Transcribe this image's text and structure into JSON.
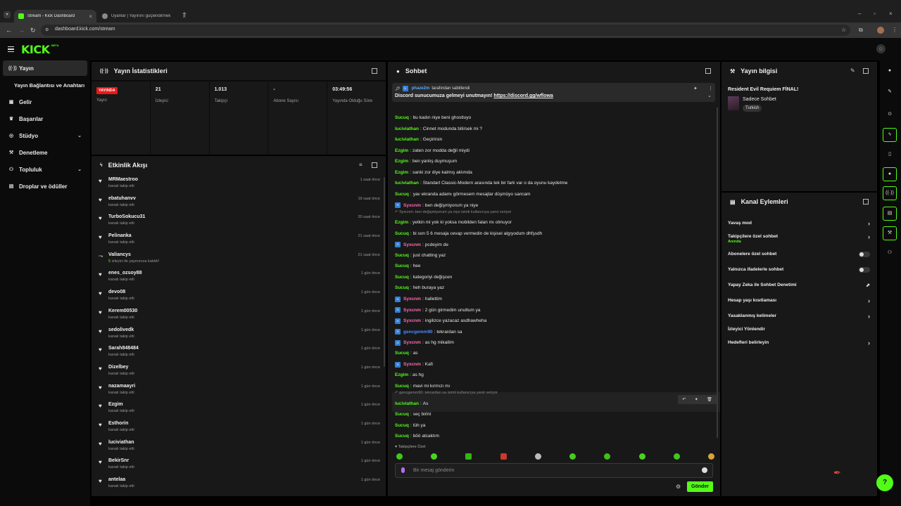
{
  "browser": {
    "tabs": [
      {
        "title": "Stream - Kick Dashboard"
      },
      {
        "title": "Uyanlar | Yayınını güçlendirmek"
      }
    ],
    "url": "dashboard.kick.com/stream"
  },
  "header": {
    "logo": "KICK",
    "logo_badge": "BETA"
  },
  "sidebar": {
    "items": [
      {
        "label": "Yayın",
        "icon": "broadcast-icon"
      },
      {
        "label": "Yayın Bağlantısı ve Anahtarı",
        "icon": ""
      },
      {
        "label": "Gelir",
        "icon": "wallet-icon"
      },
      {
        "label": "Başarılar",
        "icon": "trophy-icon"
      },
      {
        "label": "Stüdyo",
        "icon": "studio-icon"
      },
      {
        "label": "Denetleme",
        "icon": "wrench-icon"
      },
      {
        "label": "Topluluk",
        "icon": "community-icon"
      },
      {
        "label": "Droplar ve ödüller",
        "icon": "gift-icon"
      }
    ]
  },
  "stats": {
    "title": "Yayın İstatistikleri",
    "live_badge": "YAYINDA",
    "cells": [
      {
        "value": "",
        "label": "Yayın"
      },
      {
        "value": "21",
        "label": "İzleyici"
      },
      {
        "value": "1.013",
        "label": "Takipçi"
      },
      {
        "value": "-",
        "label": "Abone Sayısı"
      },
      {
        "value": "03:49:56",
        "label": "Yayında Olduğu Süre"
      }
    ]
  },
  "activity": {
    "title": "Etkinlik Akışı",
    "items": [
      {
        "name": "MRMaestroo",
        "sub": "kanalı takip etti",
        "time": "1 saat önce",
        "icon": "heart"
      },
      {
        "name": "ebatuhanvv",
        "sub": "kanalı takip etti",
        "time": "19 saat önce",
        "icon": "heart"
      },
      {
        "name": "TurboSokucu31",
        "sub": "kanalı takip etti",
        "time": "20 saat önce",
        "icon": "heart"
      },
      {
        "name": "Pelinanka",
        "sub": "kanalı takip etti",
        "time": "21 saat önce",
        "icon": "heart"
      },
      {
        "name": "Valiancys",
        "sub_count": "5",
        "sub": "izleyici ile yayınınıza katıldı!",
        "time": "21 saat önce",
        "icon": "raid"
      },
      {
        "name": "enes_ozsoy88",
        "sub": "kanalı takip etti",
        "time": "1 gün önce",
        "icon": "heart"
      },
      {
        "name": "devo08",
        "sub": "kanalı takip etti",
        "time": "1 gün önce",
        "icon": "heart"
      },
      {
        "name": "Kerem00530",
        "sub": "kanalı takip etti",
        "time": "1 gün önce",
        "icon": "heart"
      },
      {
        "name": "sedolivedk",
        "sub": "kanalı takip etti",
        "time": "1 gün önce",
        "icon": "heart"
      },
      {
        "name": "Sarah848484",
        "sub": "kanalı takip etti",
        "time": "1 gün önce",
        "icon": "heart"
      },
      {
        "name": "Dizelbey",
        "sub": "kanalı takip etti",
        "time": "1 gün önce",
        "icon": "heart"
      },
      {
        "name": "nazamaayri",
        "sub": "kanalı takip etti",
        "time": "1 gün önce",
        "icon": "heart"
      },
      {
        "name": "Ezgim",
        "sub": "kanalı takip etti",
        "time": "1 gün önce",
        "icon": "heart"
      },
      {
        "name": "Esthorin",
        "sub": "kanalı takip etti",
        "time": "1 gün önce",
        "icon": "heart"
      },
      {
        "name": "luciviathan",
        "sub": "kanalı takip etti",
        "time": "1 gün önce",
        "icon": "heart"
      },
      {
        "name": "BekirSnr",
        "sub": "kanalı takip etti",
        "time": "1 gün önce",
        "icon": "heart"
      },
      {
        "name": "antelaa",
        "sub": "kanalı takip etti",
        "time": "1 gün önce",
        "icon": "heart"
      }
    ]
  },
  "chat": {
    "title": "Sohbet",
    "pinned": {
      "user": "phaze2m",
      "by_text": "tarafından sabitlendi",
      "message": "Discord sunucumuza gelmeyi unutmayın!",
      "link": "https://discord.gg/wflowa"
    },
    "messages": [
      {
        "user": "Sucuq",
        "color": "green",
        "text": "bu kadın niye beni ghostluyo"
      },
      {
        "user": "luciviathan",
        "color": "green",
        "text": "Cinnet modunda bitirsek mi ?"
      },
      {
        "user": "luciviathan",
        "color": "green",
        "text": "Geçirirsin"
      },
      {
        "user": "Ezgim",
        "color": "green",
        "text": "zaten zor modda değil miydi"
      },
      {
        "user": "Ezgim",
        "color": "green",
        "text": "ben yanlış duymuşum"
      },
      {
        "user": "Ezgim",
        "color": "green",
        "text": "sanki zor diye kalmış aklımda"
      },
      {
        "user": "luciviathan",
        "color": "green",
        "text": "Standart Classic-Modern arasında tek bir fark var o da oyunu kaydetme"
      },
      {
        "user": "Sucuq",
        "color": "green",
        "text": "yav ekranda adamı görmesem mesajlar düşmüyo sancam"
      },
      {
        "user": "Syxcnm",
        "color": "pink",
        "badge": true,
        "text": "ben değişmiyorum ya niye"
      },
      {
        "reply": "Syxcnm: ben değişmiyorum ya niye isimli kullanıcıya yanıt veriyor"
      },
      {
        "user": "Ezgim",
        "color": "green",
        "text": "yetkin mi yok ki yoksa mobilden falan mı olmuyor"
      },
      {
        "user": "Sucuq",
        "color": "green",
        "text": "bi son 5 6 mesaja cevap vermedin de kişisel algıyodum dhfşsdh"
      },
      {
        "user": "Syxcnm",
        "color": "pink",
        "badge": true,
        "text": "pcdeyim de"
      },
      {
        "user": "Sucuq",
        "color": "green",
        "text": "just chatting yaz"
      },
      {
        "user": "Sucuq",
        "color": "green",
        "text": "hee"
      },
      {
        "user": "Sucuq",
        "color": "green",
        "text": "kategoriyi değişcen"
      },
      {
        "user": "Sucuq",
        "color": "green",
        "text": "heh buraya yaz"
      },
      {
        "user": "Syxcnm",
        "color": "pink",
        "badge": true,
        "text": "hallettim"
      },
      {
        "user": "Syxcnm",
        "color": "pink",
        "badge": true,
        "text": "2 gün girmedim unuttum ya"
      },
      {
        "user": "Syxcnm",
        "color": "pink",
        "badge": true,
        "text": "ingilizce yazacaz asdhawheha"
      },
      {
        "user": "gencgemm90",
        "color": "blue",
        "badge": true,
        "text": "tekrardan sa"
      },
      {
        "user": "Syxcnm",
        "color": "pink",
        "badge": true,
        "text": "as hg mikailim"
      },
      {
        "user": "Sucuq",
        "color": "green",
        "text": "as"
      },
      {
        "user": "Syxcnm",
        "color": "pink",
        "badge": true,
        "text": "Kafi"
      },
      {
        "user": "Ezgim",
        "color": "green",
        "text": "as hg"
      },
      {
        "user": "Sucuq",
        "color": "green",
        "text": "mavi mi kırmızı mı"
      },
      {
        "reply": "gencgemm90: tekrardan sa isimli kullanıcıya yanıt veriyor"
      },
      {
        "user": "luciviathan",
        "color": "green",
        "text": "As"
      },
      {
        "user": "Sucuq",
        "color": "green",
        "text": "seç birini"
      },
      {
        "user": "Sucuq",
        "color": "green",
        "text": "tüh ya"
      },
      {
        "user": "Sucuq",
        "color": "green",
        "text": "böö atcaktım"
      }
    ],
    "followers_only": "Takipçilere Özel",
    "input_placeholder": "Bir mesaj gönderin",
    "send_label": "Gönder"
  },
  "stream_info": {
    "title_label": "Yayın bilgisi",
    "stream_title": "Resident Evil Requiem FİNAL!",
    "category": "Sadece Sohbet",
    "tag": "Turkish"
  },
  "channel_actions": {
    "title": "Kanal Eylemleri",
    "items": [
      {
        "label": "Yavaş mod",
        "control": "chevron"
      },
      {
        "label": "Takipçilere özel sohbet",
        "sub": "Anında",
        "control": "chevron"
      },
      {
        "label": "Abonelere özel sohbet",
        "control": "toggle"
      },
      {
        "label": "Yalnızca ifadelerle sohbet",
        "control": "toggle"
      },
      {
        "label": "Yapay Zeka ile Sohbet Denetimi",
        "control": "external"
      },
      {
        "label": "Hesap yaşı kısıtlaması",
        "control": "chevron"
      },
      {
        "label": "Yasaklanmış kelimeler",
        "control": "chevron"
      },
      {
        "label": "İzleyici Yönlendir",
        "control": "none"
      },
      {
        "label": "Hedefleri belirleyin",
        "control": "chevron"
      }
    ]
  },
  "colors": {
    "accent": "#53fc18",
    "live": "#e91916",
    "panel": "#181818",
    "bg": "#0b0b0b"
  }
}
